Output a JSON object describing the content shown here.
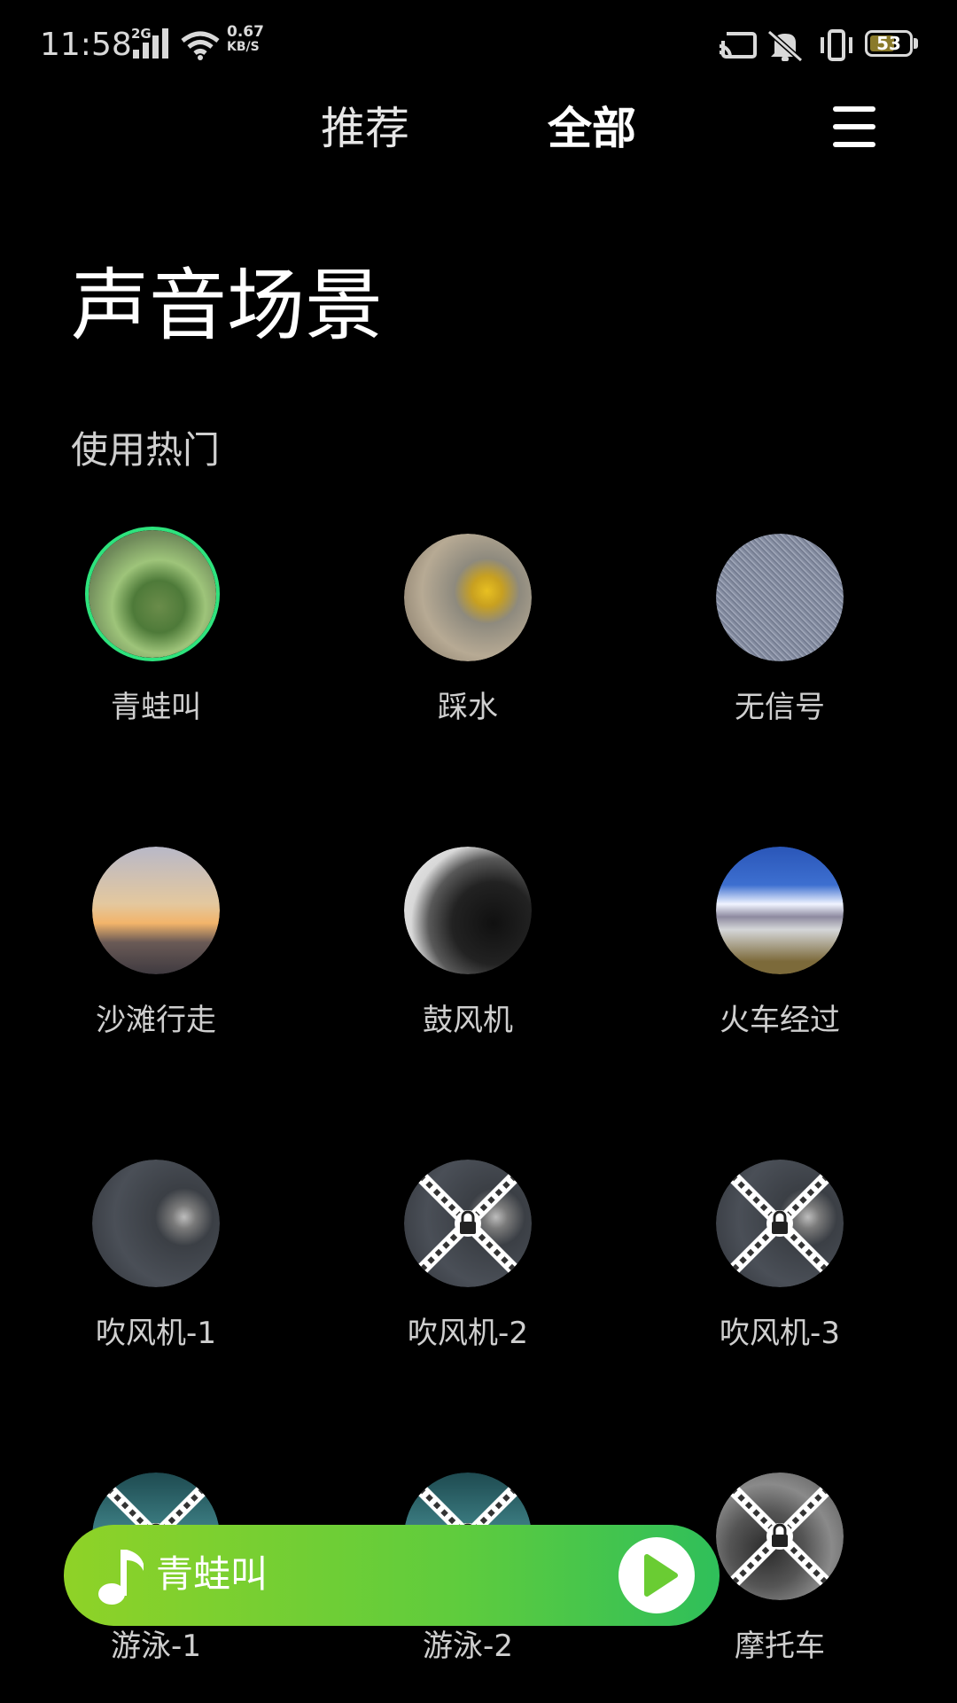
{
  "status": {
    "time": "11:58",
    "network_type": "2G",
    "speed_value": "0.67",
    "speed_unit": "KB/S",
    "battery": "53"
  },
  "tabs": [
    {
      "label": "推荐",
      "active": false
    },
    {
      "label": "全部",
      "active": true
    }
  ],
  "menu_icon": "hamburger-menu-icon",
  "title": "声音场景",
  "section": "使用热门",
  "items": [
    {
      "label": "青蛙叫",
      "selected": true,
      "locked": false,
      "thumb": "frog"
    },
    {
      "label": "踩水",
      "selected": false,
      "locked": false,
      "thumb": "splash"
    },
    {
      "label": "无信号",
      "selected": false,
      "locked": false,
      "thumb": "static"
    },
    {
      "label": "沙滩行走",
      "selected": false,
      "locked": false,
      "thumb": "beach"
    },
    {
      "label": "鼓风机",
      "selected": false,
      "locked": false,
      "thumb": "blower"
    },
    {
      "label": "火车经过",
      "selected": false,
      "locked": false,
      "thumb": "train"
    },
    {
      "label": "吹风机-1",
      "selected": false,
      "locked": false,
      "thumb": "dryer"
    },
    {
      "label": "吹风机-2",
      "selected": false,
      "locked": true,
      "thumb": "dryer"
    },
    {
      "label": "吹风机-3",
      "selected": false,
      "locked": true,
      "thumb": "dryer"
    },
    {
      "label": "游泳-1",
      "selected": false,
      "locked": true,
      "thumb": "swim"
    },
    {
      "label": "游泳-2",
      "selected": false,
      "locked": true,
      "thumb": "swim"
    },
    {
      "label": "摩托车",
      "selected": false,
      "locked": true,
      "thumb": "moto"
    }
  ],
  "player": {
    "title": "青蛙叫",
    "note_icon": "music-note-icon",
    "play_icon": "play-icon"
  },
  "colors": {
    "selected_ring": "#2ee37d",
    "player_gradient_start": "#8fd227",
    "player_gradient_end": "#2fbf5a"
  }
}
